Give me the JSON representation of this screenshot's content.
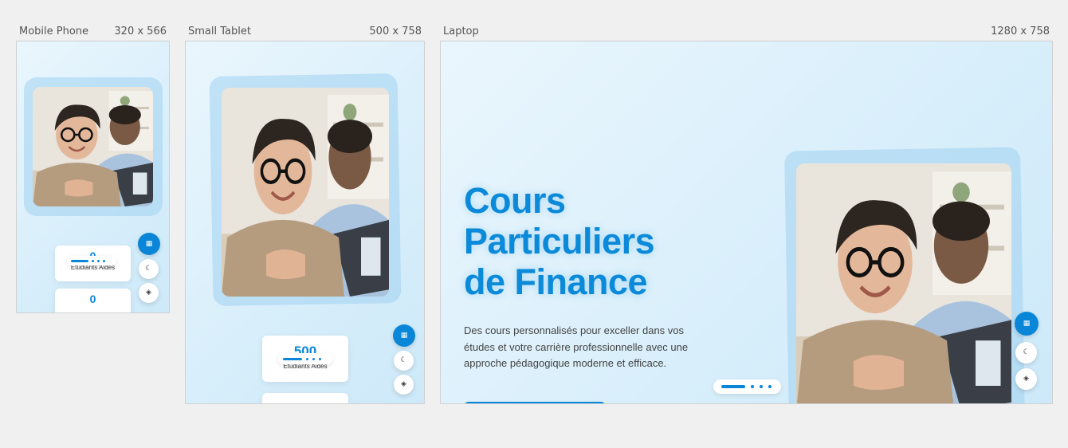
{
  "devices": [
    {
      "name": "Mobile Phone",
      "size": "320 x 566"
    },
    {
      "name": "Small Tablet",
      "size": "500 x 758"
    },
    {
      "name": "Laptop",
      "size": "1280 x 758"
    }
  ],
  "hero": {
    "title_lines": [
      "Cours",
      "Particuliers",
      "de Finance"
    ],
    "description_lines": [
      "Des cours personnalisés pour exceller dans vos",
      "études et votre carrière professionnelle avec une",
      "approche pédagogique moderne et efficace."
    ]
  },
  "stats": {
    "mobile": [
      {
        "value": "0",
        "label": "Étudiants Aidés"
      },
      {
        "value": "0",
        "label": ""
      }
    ],
    "tablet": [
      {
        "value": "500",
        "label": "Étudiants Aidés"
      }
    ]
  },
  "icons": {
    "calendar": "calendar-icon",
    "theme": "moon-icon",
    "language": "globe-icon"
  },
  "colors": {
    "accent": "#0a86d8",
    "background": "#f0f0f0",
    "frame_gradient_start": "#eaf6fd",
    "frame_gradient_end": "#cde9f9"
  }
}
